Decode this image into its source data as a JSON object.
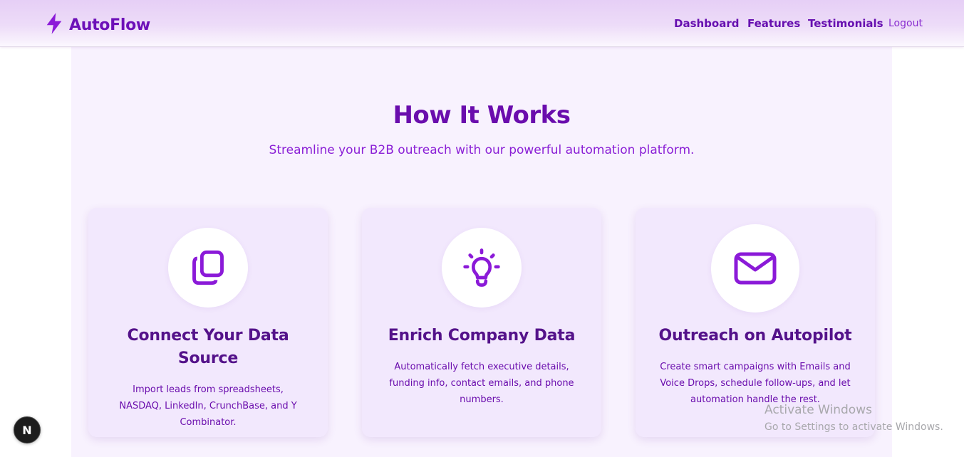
{
  "brand": {
    "name": "AutoFlow",
    "icon": "lightning-bolt-icon",
    "accent_color": "#8b1ad8"
  },
  "nav": {
    "dashboard": "Dashboard",
    "features": "Features",
    "testimonials": "Testimonials",
    "logout": "Logout"
  },
  "hero": {
    "title": "How It Works",
    "subtitle": "Streamline your B2B outreach with our powerful automation platform."
  },
  "cards": [
    {
      "icon": "copy-documents-icon",
      "title": "Connect Your Data Source",
      "description": "Import leads from spreadsheets, NASDAQ, LinkedIn, CrunchBase, and Y Combinator."
    },
    {
      "icon": "lightbulb-icon",
      "title": "Enrich Company Data",
      "description": "Automatically fetch executive details, funding info, contact emails, and phone numbers."
    },
    {
      "icon": "envelope-icon",
      "title": "Outreach on Autopilot",
      "description": "Create smart campaigns with Emails and Voice Drops, schedule follow-ups, and let automation handle the rest."
    }
  ],
  "os_watermark": {
    "title": "Activate Windows",
    "subtitle": "Go to Settings to activate Windows."
  },
  "dev_badge": {
    "label": "N"
  }
}
